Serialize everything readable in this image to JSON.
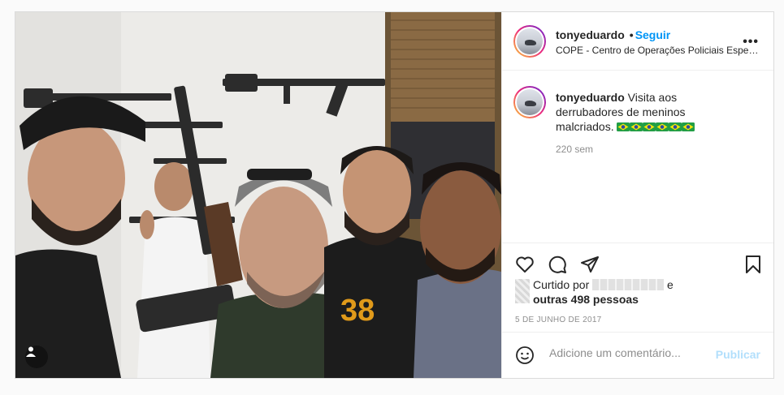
{
  "post": {
    "username": "tonyeduardo",
    "follow_label": "Seguir",
    "location": "COPE - Centro de Operações Policiais Especiais",
    "more_icon": "more-horizontal-icon",
    "caption_text": "Visita aos derrubadores de meninos malcriados.",
    "caption_flags_count": 6,
    "caption_time": "220 sem",
    "liked_prefix": "Curtido por",
    "liked_suffix": "e",
    "liked_others": "outras 498 pessoas",
    "date": "5 DE JUNHO DE 2017",
    "comment_placeholder": "Adicione um comentário...",
    "publish_label": "Publicar"
  },
  "icons": {
    "like": "heart-icon",
    "comment": "speech-bubble-icon",
    "share": "paper-plane-icon",
    "save": "bookmark-icon",
    "emoji": "smiley-icon",
    "tag": "user-tag-icon"
  },
  "colors": {
    "accent": "#0095f6",
    "muted": "#8e8e8e",
    "publish_disabled": "#b2dffc",
    "border": "#dbdbdb"
  }
}
